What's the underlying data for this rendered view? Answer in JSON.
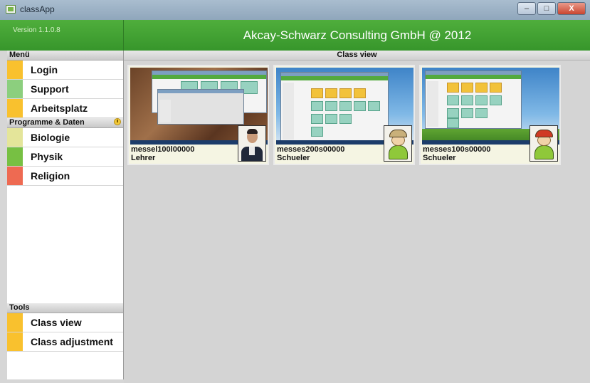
{
  "window": {
    "title": "classApp",
    "min": "–",
    "max": "□",
    "close": "X"
  },
  "header": {
    "version": "Version 1.1.0.8",
    "company": "Akcay-Schwarz Consulting GmbH @ 2012"
  },
  "sidebar": {
    "menu_header": "Menü",
    "menu_items": [
      {
        "label": "Login",
        "color": "#f9c12e"
      },
      {
        "label": "Support",
        "color": "#8ccf7e"
      },
      {
        "label": "Arbeitsplatz",
        "color": "#f9c12e"
      }
    ],
    "programs_header": "Programme & Daten",
    "program_items": [
      {
        "label": "Biologie",
        "color": "#e4e59a"
      },
      {
        "label": "Physik",
        "color": "#77c043"
      },
      {
        "label": "Religion",
        "color": "#ee6a52"
      }
    ],
    "tools_header": "Tools",
    "tool_items": [
      {
        "label": "Class view",
        "color": "#f9c12e"
      },
      {
        "label": "Class adjustment",
        "color": "#f9c12e"
      }
    ]
  },
  "main": {
    "title": "Class view",
    "cards": [
      {
        "name": "messel100l00000",
        "role": "Lehrer",
        "avatar": "teacher-photo"
      },
      {
        "name": "messes200s00000",
        "role": "Schueler",
        "avatar": "student-avatar-khaki"
      },
      {
        "name": "messes100s00000",
        "role": "Schueler",
        "avatar": "student-avatar-red"
      }
    ]
  }
}
